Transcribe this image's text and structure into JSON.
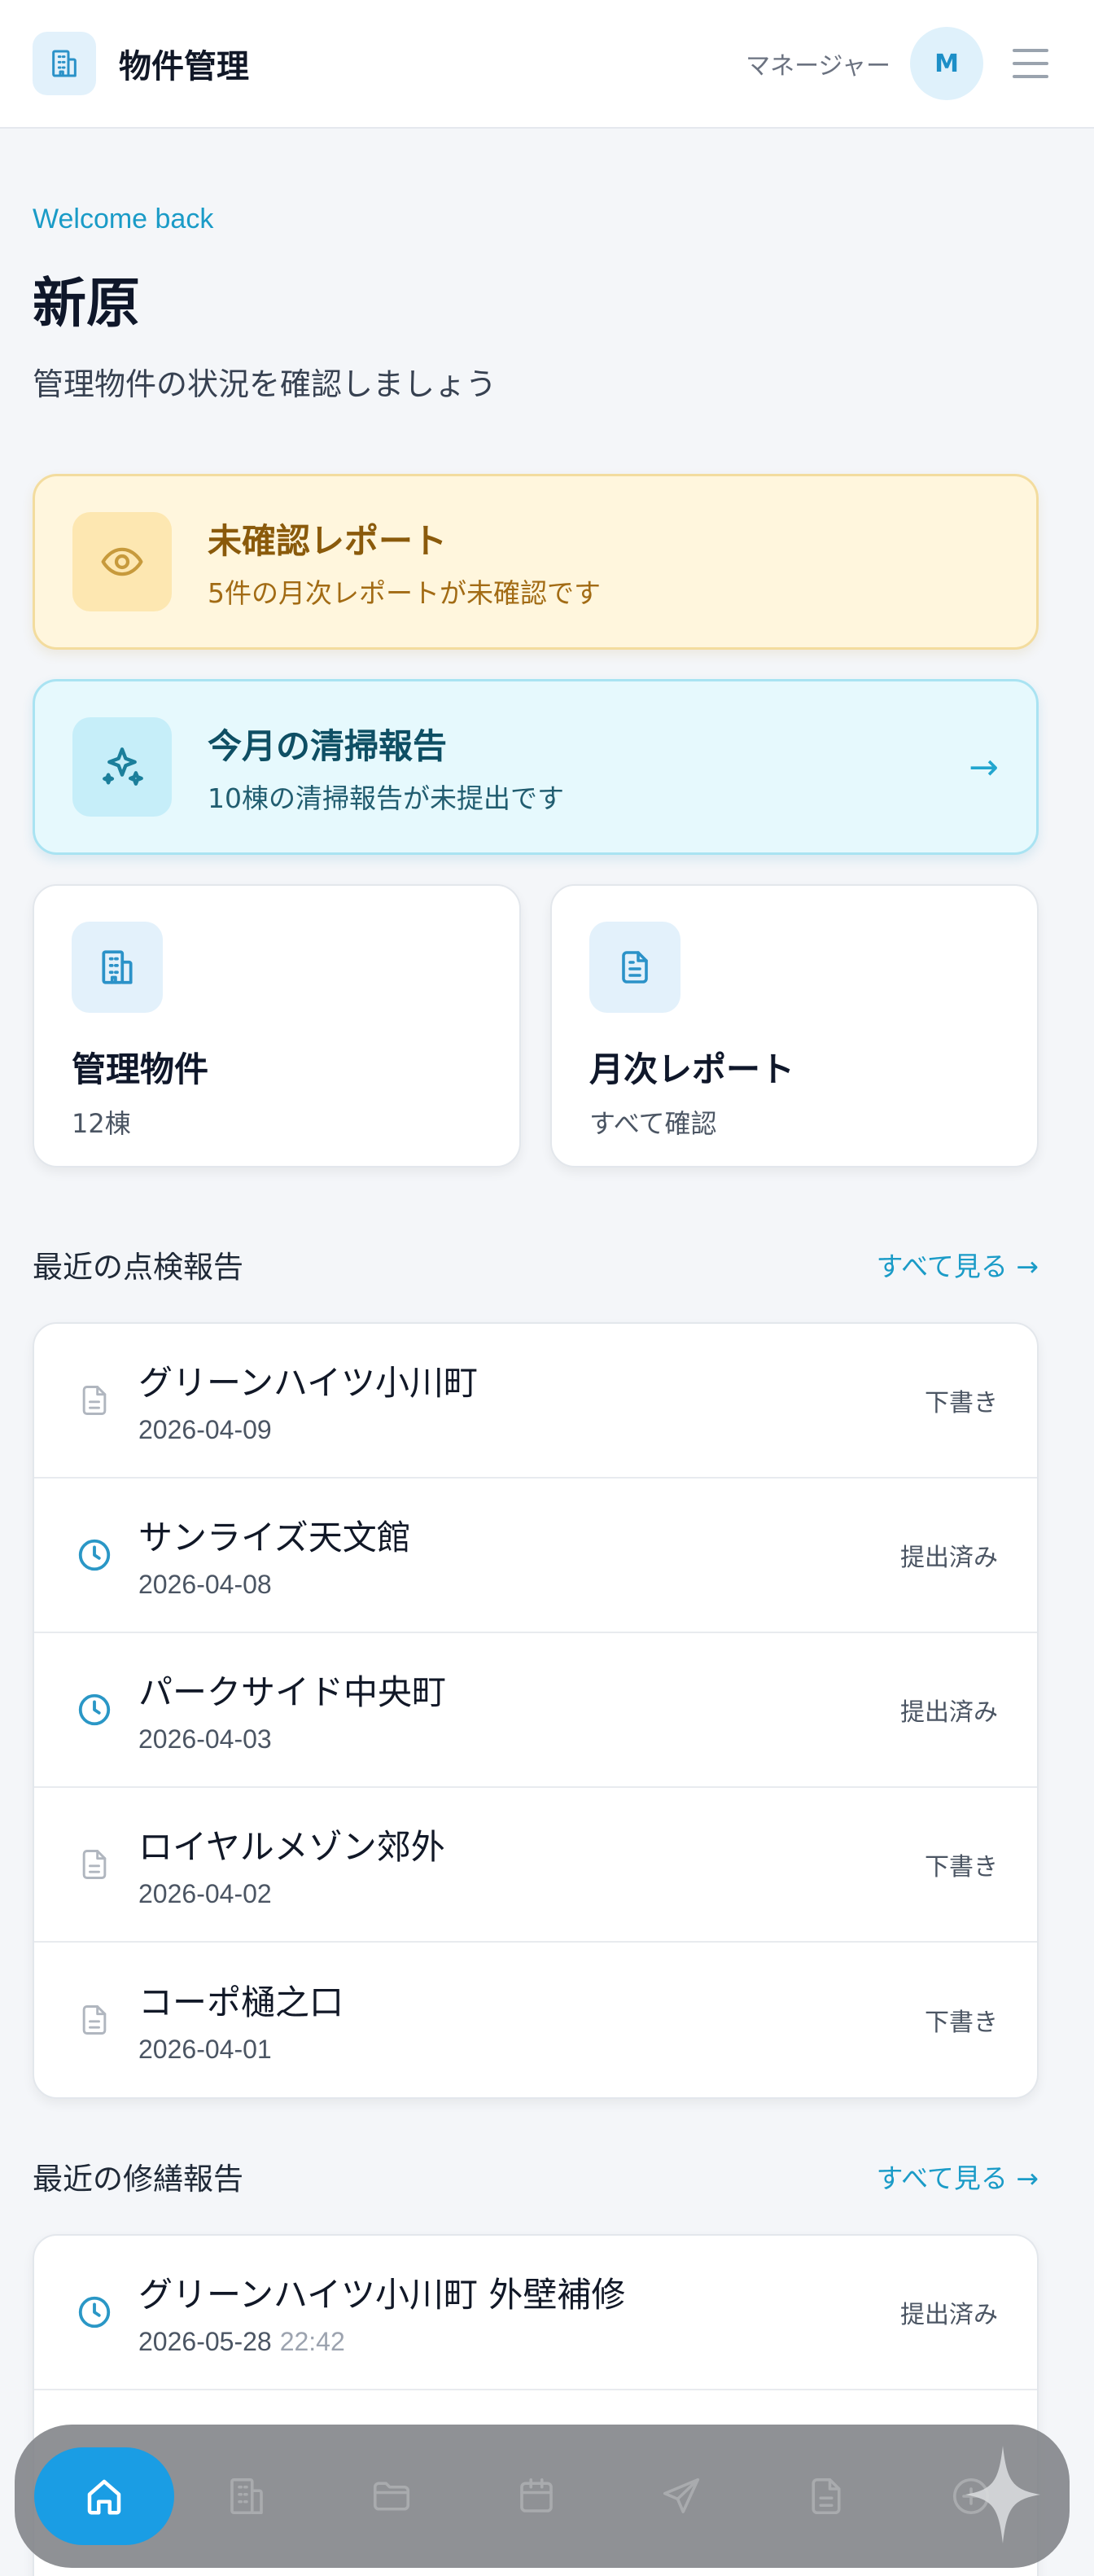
{
  "header": {
    "title": "物件管理",
    "role": "マネージャー",
    "avatar_initial": "M"
  },
  "welcome": {
    "eyebrow": "Welcome back",
    "name": "新原",
    "subtitle": "管理物件の状況を確認しましょう"
  },
  "alerts": {
    "unread": {
      "title": "未確認レポート",
      "description": "5件の月次レポートが未確認です",
      "icon": "eye-icon",
      "color": "#fff6dd"
    },
    "cleaning": {
      "title": "今月の清掃報告",
      "description": "10棟の清掃報告が未提出です",
      "icon": "sparkles-icon",
      "color": "#e6f9fd"
    }
  },
  "stats": {
    "properties": {
      "title": "管理物件",
      "value": "12棟",
      "icon": "building-icon"
    },
    "reports": {
      "title": "月次レポート",
      "value": "すべて確認",
      "icon": "document-icon"
    }
  },
  "inspections": {
    "title": "最近の点検報告",
    "see_all": "すべて見る →",
    "items": [
      {
        "name": "グリーンハイツ小川町",
        "date": "2026-04-09",
        "status": "下書き",
        "icon": "file-icon"
      },
      {
        "name": "サンライズ天文館",
        "date": "2026-04-08",
        "status": "提出済み",
        "icon": "clock-icon"
      },
      {
        "name": "パークサイド中央町",
        "date": "2026-04-03",
        "status": "提出済み",
        "icon": "clock-icon"
      },
      {
        "name": "ロイヤルメゾン郊外",
        "date": "2026-04-02",
        "status": "下書き",
        "icon": "file-icon"
      },
      {
        "name": "コーポ樋之口",
        "date": "2026-04-01",
        "status": "下書き",
        "icon": "file-icon"
      }
    ]
  },
  "repairs": {
    "title": "最近の修繕報告",
    "see_all": "すべて見る →",
    "items": [
      {
        "name": "グリーンハイツ小川町 外壁補修",
        "date": "2026-05-28",
        "time": "22:42",
        "status": "提出済み",
        "icon": "clock-icon"
      }
    ]
  },
  "nav": {
    "items": [
      "home-icon",
      "building-icon",
      "folder-icon",
      "calendar-icon",
      "send-icon",
      "document-icon",
      "plus-circle-icon"
    ],
    "accent": "#1a9de4"
  }
}
